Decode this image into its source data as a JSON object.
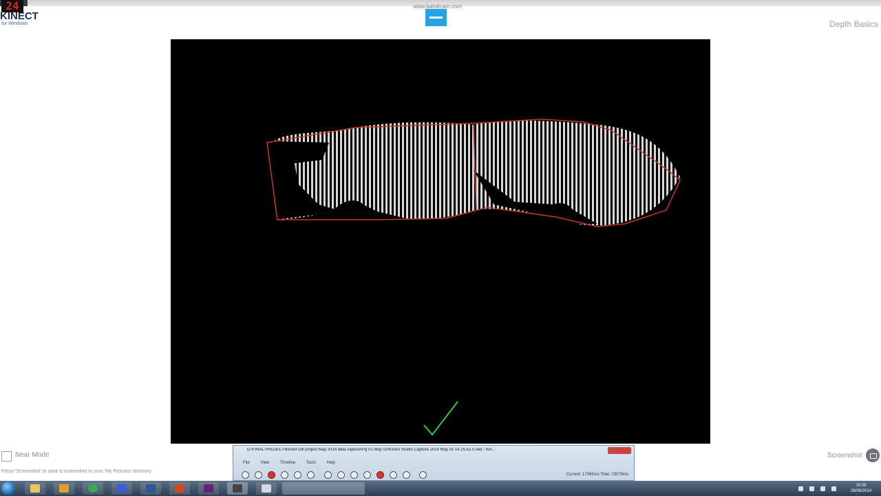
{
  "overlay": {
    "fps": "24",
    "watermark": "www.bandicam.com"
  },
  "app": {
    "logo": "KINECT",
    "logo_sub": "for Windows",
    "title": "Depth Basics"
  },
  "controls": {
    "near_mode_label": "Near Mode",
    "near_mode_checked": false,
    "hint": "Press 'Screenshot' to save a screenshot to your 'My Pictures' directory",
    "screenshot_label": "Screenshot"
  },
  "studio_window": {
    "title": "D:\\FINAL PROJECT\\Kinect DB project May 2014 data capture\\Pg 01 May 02\\Kinect Studio Capture 2014 May 02 14.25.52.0.xed - Kin...",
    "menu": [
      "File",
      "View",
      "Timeline",
      "Tools",
      "Help"
    ],
    "time_readout": "Current: 17065ms  Total: 23079ms"
  },
  "taskbar": {
    "clock_time": "10:25",
    "clock_date": "26/06/2014"
  },
  "colors": {
    "outline": "#c0392b",
    "stripes": "#d8d8d8",
    "checkmark": "#2ecc40"
  }
}
